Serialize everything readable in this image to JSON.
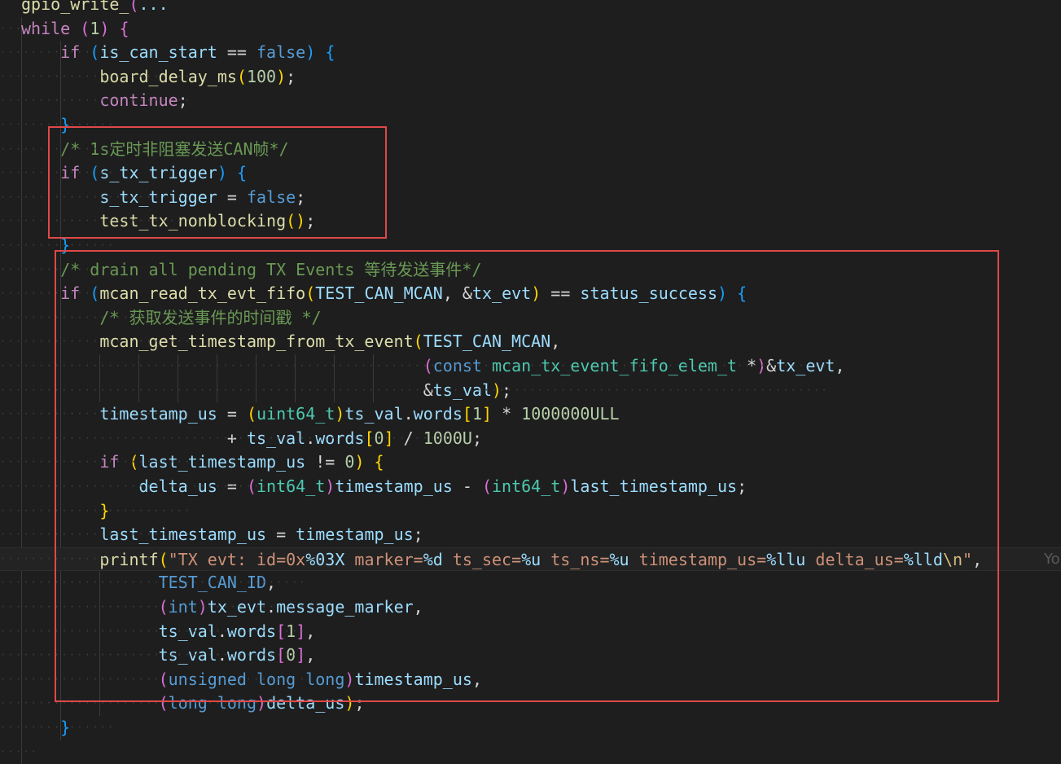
{
  "editor": {
    "lines": [
      [
        {
          "t": "gpio_",
          "c": "fn"
        },
        {
          "t": "write_",
          "c": "fn"
        },
        {
          "t": "(",
          "c": "p2"
        },
        {
          "t": "...",
          "c": "var"
        }
      ],
      [
        {
          "t": "while",
          "c": "ctl"
        },
        {
          "t": " ",
          "c": "b0"
        },
        {
          "t": "(",
          "c": "p2"
        },
        {
          "t": "1",
          "c": "num"
        },
        {
          "t": ")",
          "c": "p2"
        },
        {
          "t": " ",
          "c": "b0"
        },
        {
          "t": "{",
          "c": "p2"
        }
      ],
      [
        {
          "t": "    if",
          "c": "ctl"
        },
        {
          "t": " ",
          "c": "b0"
        },
        {
          "t": "(",
          "c": "p3"
        },
        {
          "t": "is_can_start",
          "c": "var"
        },
        {
          "t": " == ",
          "c": "op"
        },
        {
          "t": "false",
          "c": "kw"
        },
        {
          "t": ")",
          "c": "p3"
        },
        {
          "t": " ",
          "c": "b0"
        },
        {
          "t": "{",
          "c": "p3"
        }
      ],
      [
        {
          "t": "        board_delay_ms",
          "c": "fn"
        },
        {
          "t": "(",
          "c": "p1"
        },
        {
          "t": "100",
          "c": "num"
        },
        {
          "t": ")",
          "c": "p1"
        },
        {
          "t": ";",
          "c": "b0"
        }
      ],
      [
        {
          "t": "        continue",
          "c": "ctl"
        },
        {
          "t": ";",
          "c": "b0"
        }
      ],
      [
        {
          "t": "    }",
          "c": "p3"
        }
      ],
      [
        {
          "t": "    /* 1s定时非阻塞发送CAN帧*/",
          "c": "cmt"
        }
      ],
      [
        {
          "t": "    if",
          "c": "ctl"
        },
        {
          "t": " ",
          "c": "b0"
        },
        {
          "t": "(",
          "c": "p3"
        },
        {
          "t": "s_tx_trigger",
          "c": "var"
        },
        {
          "t": ")",
          "c": "p3"
        },
        {
          "t": " ",
          "c": "b0"
        },
        {
          "t": "{",
          "c": "p3"
        }
      ],
      [
        {
          "t": "        s_tx_trigger",
          "c": "var"
        },
        {
          "t": " = ",
          "c": "op"
        },
        {
          "t": "false",
          "c": "kw"
        },
        {
          "t": ";",
          "c": "b0"
        }
      ],
      [
        {
          "t": "        test_tx_nonblocking",
          "c": "fn"
        },
        {
          "t": "()",
          "c": "p1"
        },
        {
          "t": ";",
          "c": "b0"
        }
      ],
      [
        {
          "t": "    }",
          "c": "p3"
        }
      ],
      [
        {
          "t": "    /* drain all pending TX Events 等待发送事件*/",
          "c": "cmt"
        }
      ],
      [
        {
          "t": "    if",
          "c": "ctl"
        },
        {
          "t": " ",
          "c": "b0"
        },
        {
          "t": "(",
          "c": "p3"
        },
        {
          "t": "mcan_read_tx_evt_fifo",
          "c": "fn"
        },
        {
          "t": "(",
          "c": "p1"
        },
        {
          "t": "TEST_CAN_MCAN",
          "c": "var"
        },
        {
          "t": ", ",
          "c": "b0"
        },
        {
          "t": "&",
          "c": "op"
        },
        {
          "t": "tx_evt",
          "c": "var"
        },
        {
          "t": ")",
          "c": "p1"
        },
        {
          "t": " == ",
          "c": "op"
        },
        {
          "t": "status_success",
          "c": "var"
        },
        {
          "t": ")",
          "c": "p3"
        },
        {
          "t": " ",
          "c": "b0"
        },
        {
          "t": "{",
          "c": "p3"
        }
      ],
      [
        {
          "t": "        /* 获取发送事件的时间戳 */",
          "c": "cmt"
        }
      ],
      [
        {
          "t": "        mcan_get_timestamp_from_tx_event",
          "c": "fn"
        },
        {
          "t": "(",
          "c": "p1"
        },
        {
          "t": "TEST_CAN_MCAN",
          "c": "var"
        },
        {
          "t": ",",
          "c": "b0"
        }
      ],
      [
        {
          "t": "                                         ",
          "c": "b0"
        },
        {
          "t": "(",
          "c": "p2"
        },
        {
          "t": "const",
          "c": "kw"
        },
        {
          "t": " ",
          "c": "b0"
        },
        {
          "t": "mcan_tx_event_fifo_elem_t",
          "c": "typ"
        },
        {
          "t": " *",
          "c": "op"
        },
        {
          "t": ")",
          "c": "p2"
        },
        {
          "t": "&",
          "c": "op"
        },
        {
          "t": "tx_evt",
          "c": "var"
        },
        {
          "t": ",",
          "c": "b0"
        }
      ],
      [
        {
          "t": "                                         ",
          "c": "b0"
        },
        {
          "t": "&",
          "c": "op"
        },
        {
          "t": "ts_val",
          "c": "var"
        },
        {
          "t": ")",
          "c": "p1"
        },
        {
          "t": ";",
          "c": "b0"
        }
      ],
      [
        {
          "t": "        timestamp_us",
          "c": "var"
        },
        {
          "t": " = ",
          "c": "op"
        },
        {
          "t": "(",
          "c": "p1"
        },
        {
          "t": "uint64_t",
          "c": "typ"
        },
        {
          "t": ")",
          "c": "p1"
        },
        {
          "t": "ts_val",
          "c": "var"
        },
        {
          "t": ".",
          "c": "b0"
        },
        {
          "t": "words",
          "c": "var"
        },
        {
          "t": "[",
          "c": "p1"
        },
        {
          "t": "1",
          "c": "num"
        },
        {
          "t": "]",
          "c": "p1"
        },
        {
          "t": " * ",
          "c": "op"
        },
        {
          "t": "1000000ULL",
          "c": "num"
        }
      ],
      [
        {
          "t": "                     + ",
          "c": "op"
        },
        {
          "t": "ts_val",
          "c": "var"
        },
        {
          "t": ".",
          "c": "b0"
        },
        {
          "t": "words",
          "c": "var"
        },
        {
          "t": "[",
          "c": "p1"
        },
        {
          "t": "0",
          "c": "num"
        },
        {
          "t": "]",
          "c": "p1"
        },
        {
          "t": " / ",
          "c": "op"
        },
        {
          "t": "1000U",
          "c": "num"
        },
        {
          "t": ";",
          "c": "b0"
        }
      ],
      [
        {
          "t": "        if",
          "c": "ctl"
        },
        {
          "t": " ",
          "c": "b0"
        },
        {
          "t": "(",
          "c": "p1"
        },
        {
          "t": "last_timestamp_us",
          "c": "var"
        },
        {
          "t": " != ",
          "c": "op"
        },
        {
          "t": "0",
          "c": "num"
        },
        {
          "t": ")",
          "c": "p1"
        },
        {
          "t": " ",
          "c": "b0"
        },
        {
          "t": "{",
          "c": "p1"
        }
      ],
      [
        {
          "t": "            delta_us",
          "c": "var"
        },
        {
          "t": " = ",
          "c": "op"
        },
        {
          "t": "(",
          "c": "p2"
        },
        {
          "t": "int64_t",
          "c": "typ"
        },
        {
          "t": ")",
          "c": "p2"
        },
        {
          "t": "timestamp_us",
          "c": "var"
        },
        {
          "t": " - ",
          "c": "op"
        },
        {
          "t": "(",
          "c": "p2"
        },
        {
          "t": "int64_t",
          "c": "typ"
        },
        {
          "t": ")",
          "c": "p2"
        },
        {
          "t": "last_timestamp_us",
          "c": "var"
        },
        {
          "t": ";",
          "c": "b0"
        }
      ],
      [
        {
          "t": "        }",
          "c": "p1"
        }
      ],
      [
        {
          "t": "        last_timestamp_us",
          "c": "var"
        },
        {
          "t": " = ",
          "c": "op"
        },
        {
          "t": "timestamp_us",
          "c": "var"
        },
        {
          "t": ";",
          "c": "b0"
        }
      ],
      [
        {
          "t": "        printf",
          "c": "fn"
        },
        {
          "t": "(",
          "c": "p1"
        },
        {
          "t": "\"TX evt: id=0x",
          "c": "str"
        },
        {
          "t": "%03X",
          "c": "fmt"
        },
        {
          "t": " marker=",
          "c": "str"
        },
        {
          "t": "%d",
          "c": "fmt"
        },
        {
          "t": " ts_sec=",
          "c": "str"
        },
        {
          "t": "%u",
          "c": "fmt"
        },
        {
          "t": " ts_ns=",
          "c": "str"
        },
        {
          "t": "%u",
          "c": "fmt"
        },
        {
          "t": " timestamp_us=",
          "c": "str"
        },
        {
          "t": "%llu",
          "c": "fmt"
        },
        {
          "t": " delta_us=",
          "c": "str"
        },
        {
          "t": "%lld",
          "c": "fmt"
        },
        {
          "t": "\\n",
          "c": "esc"
        },
        {
          "t": "\"",
          "c": "str"
        },
        {
          "t": ",",
          "c": "b0"
        }
      ],
      [
        {
          "t": "              TEST_CAN_ID",
          "c": "mac"
        },
        {
          "t": ",",
          "c": "b0"
        }
      ],
      [
        {
          "t": "              ",
          "c": "b0"
        },
        {
          "t": "(",
          "c": "p2"
        },
        {
          "t": "int",
          "c": "kw"
        },
        {
          "t": ")",
          "c": "p2"
        },
        {
          "t": "tx_evt",
          "c": "var"
        },
        {
          "t": ".",
          "c": "b0"
        },
        {
          "t": "message_marker",
          "c": "var"
        },
        {
          "t": ",",
          "c": "b0"
        }
      ],
      [
        {
          "t": "              ts_val",
          "c": "var"
        },
        {
          "t": ".",
          "c": "b0"
        },
        {
          "t": "words",
          "c": "var"
        },
        {
          "t": "[",
          "c": "p2"
        },
        {
          "t": "1",
          "c": "num"
        },
        {
          "t": "]",
          "c": "p2"
        },
        {
          "t": ",",
          "c": "b0"
        }
      ],
      [
        {
          "t": "              ts_val",
          "c": "var"
        },
        {
          "t": ".",
          "c": "b0"
        },
        {
          "t": "words",
          "c": "var"
        },
        {
          "t": "[",
          "c": "p2"
        },
        {
          "t": "0",
          "c": "num"
        },
        {
          "t": "]",
          "c": "p2"
        },
        {
          "t": ",",
          "c": "b0"
        }
      ],
      [
        {
          "t": "              ",
          "c": "b0"
        },
        {
          "t": "(",
          "c": "p2"
        },
        {
          "t": "unsigned",
          "c": "kw"
        },
        {
          "t": " ",
          "c": "b0"
        },
        {
          "t": "long",
          "c": "kw"
        },
        {
          "t": " ",
          "c": "b0"
        },
        {
          "t": "long",
          "c": "kw"
        },
        {
          "t": ")",
          "c": "p2"
        },
        {
          "t": "timestamp_us",
          "c": "var"
        },
        {
          "t": ",",
          "c": "b0"
        }
      ],
      [
        {
          "t": "              ",
          "c": "b0"
        },
        {
          "t": "(",
          "c": "p2"
        },
        {
          "t": "long",
          "c": "kw"
        },
        {
          "t": " ",
          "c": "b0"
        },
        {
          "t": "long",
          "c": "kw"
        },
        {
          "t": ")",
          "c": "p2"
        },
        {
          "t": "delta_us",
          "c": "var"
        },
        {
          "t": ")",
          "c": "p1"
        },
        {
          "t": ";",
          "c": "b0"
        }
      ],
      [
        {
          "t": "    }",
          "c": "p3"
        }
      ],
      [
        {
          "t": "",
          "c": "b0"
        }
      ]
    ],
    "inline_hint": "Yo",
    "current_line": 23
  }
}
